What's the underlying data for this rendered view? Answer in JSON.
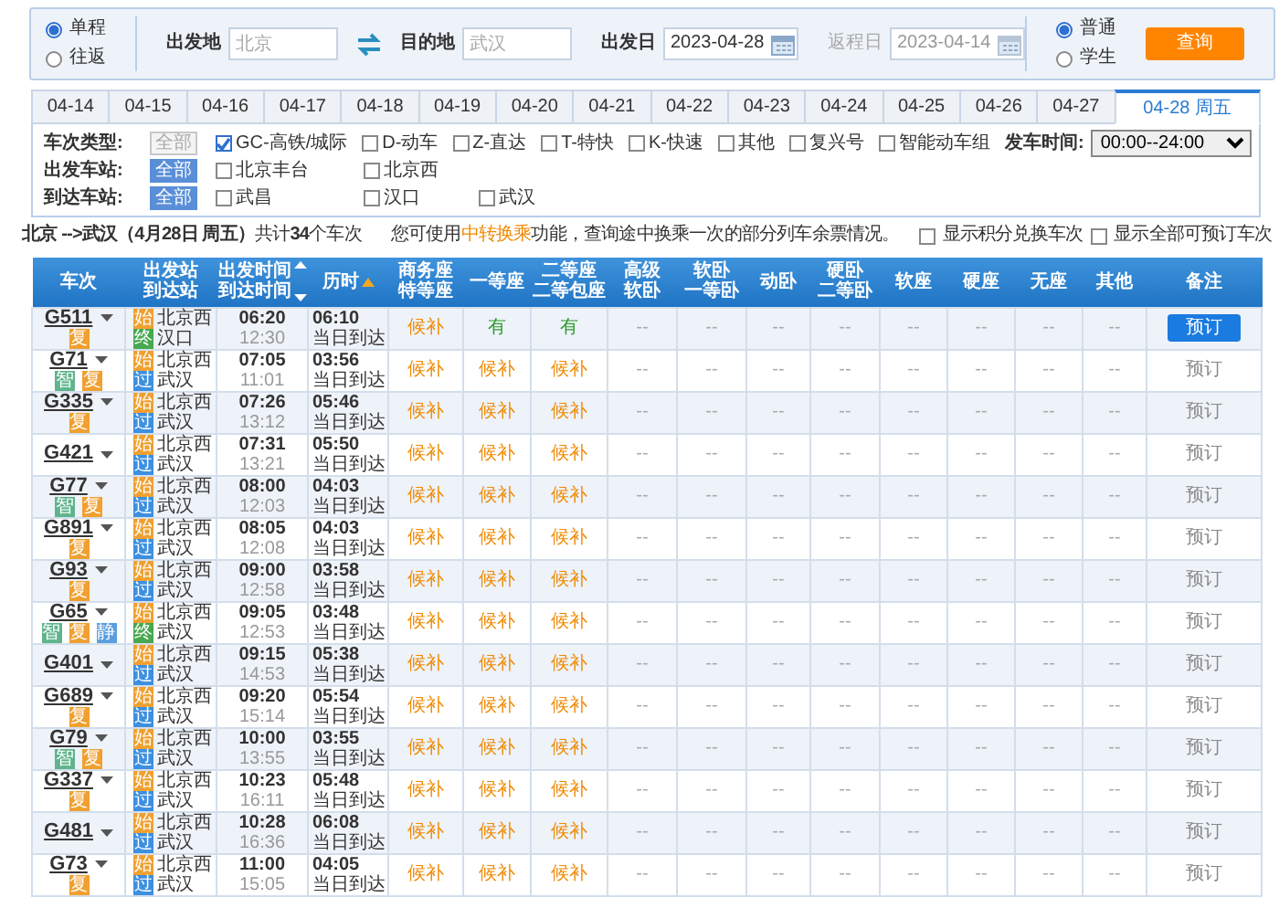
{
  "search": {
    "trip_types": [
      {
        "label": "单程",
        "selected": true
      },
      {
        "label": "往返",
        "selected": false
      }
    ],
    "from": {
      "label": "出发地",
      "placeholder": "北京"
    },
    "to": {
      "label": "目的地",
      "placeholder": "武汉"
    },
    "depart_date": {
      "label": "出发日",
      "value": "2023-04-28",
      "disabled": false
    },
    "return_date": {
      "label": "返程日",
      "value": "2023-04-14",
      "disabled": true
    },
    "passenger_types": [
      {
        "label": "普通",
        "selected": true
      },
      {
        "label": "学生",
        "selected": false
      }
    ],
    "button": "查询"
  },
  "date_tabs": [
    {
      "label": "04-14",
      "selected": false
    },
    {
      "label": "04-15",
      "selected": false
    },
    {
      "label": "04-16",
      "selected": false
    },
    {
      "label": "04-17",
      "selected": false
    },
    {
      "label": "04-18",
      "selected": false
    },
    {
      "label": "04-19",
      "selected": false
    },
    {
      "label": "04-20",
      "selected": false
    },
    {
      "label": "04-21",
      "selected": false
    },
    {
      "label": "04-22",
      "selected": false
    },
    {
      "label": "04-23",
      "selected": false
    },
    {
      "label": "04-24",
      "selected": false
    },
    {
      "label": "04-25",
      "selected": false
    },
    {
      "label": "04-26",
      "selected": false
    },
    {
      "label": "04-27",
      "selected": false
    },
    {
      "label": "04-28 周五",
      "selected": true
    }
  ],
  "filters": {
    "groups": [
      {
        "label": "车次类型:",
        "all": "全部",
        "all_selected": false,
        "options": [
          {
            "label": "GC-高铁/城际",
            "checked": true
          },
          {
            "label": "D-动车",
            "checked": false
          },
          {
            "label": "Z-直达",
            "checked": false
          },
          {
            "label": "T-特快",
            "checked": false
          },
          {
            "label": "K-快速",
            "checked": false
          },
          {
            "label": "其他",
            "checked": false
          },
          {
            "label": "复兴号",
            "checked": false
          },
          {
            "label": "智能动车组",
            "checked": false
          }
        ]
      },
      {
        "label": "出发车站:",
        "all": "全部",
        "all_selected": true,
        "options": [
          {
            "label": "北京丰台",
            "checked": false
          },
          {
            "label": "北京西",
            "checked": false
          }
        ]
      },
      {
        "label": "到达车站:",
        "all": "全部",
        "all_selected": true,
        "options": [
          {
            "label": "武昌",
            "checked": false
          },
          {
            "label": "汉口",
            "checked": false
          },
          {
            "label": "武汉",
            "checked": false
          }
        ]
      }
    ],
    "time": {
      "label": "发车时间:",
      "value": "00:00--24:00"
    }
  },
  "summary": {
    "route": "**北京 -->武汉（4月28日  周五）**共计**34**个车次",
    "notice_before": "您可使用",
    "notice_link": "中转换乘",
    "notice_after": "功能，查询途中换乘一次的部分列车余票情况。",
    "toggles": [
      {
        "label": "显示积分兑换车次",
        "checked": false
      },
      {
        "label": "显示全部可预订车次",
        "checked": false
      }
    ]
  },
  "table": {
    "columns": [
      {
        "lines": [
          "车次"
        ],
        "kind": "plain"
      },
      {
        "lines": [
          "出发站",
          "到达站"
        ],
        "kind": "plain"
      },
      {
        "lines": [
          "出发时间",
          "到达时间"
        ],
        "kind": "sortable"
      },
      {
        "lines": [
          "历时"
        ],
        "kind": "sorted"
      },
      {
        "lines": [
          "商务座",
          "特等座"
        ],
        "kind": "plain"
      },
      {
        "lines": [
          "一等座"
        ],
        "kind": "plain"
      },
      {
        "lines": [
          "二等座",
          "二等包座"
        ],
        "kind": "plain"
      },
      {
        "lines": [
          "高级",
          "软卧"
        ],
        "kind": "plain"
      },
      {
        "lines": [
          "软卧",
          "一等卧"
        ],
        "kind": "plain"
      },
      {
        "lines": [
          "动卧"
        ],
        "kind": "plain"
      },
      {
        "lines": [
          "硬卧",
          "二等卧"
        ],
        "kind": "plain"
      },
      {
        "lines": [
          "软座"
        ],
        "kind": "plain"
      },
      {
        "lines": [
          "硬座"
        ],
        "kind": "plain"
      },
      {
        "lines": [
          "无座"
        ],
        "kind": "plain"
      },
      {
        "lines": [
          "其他"
        ],
        "kind": "plain"
      },
      {
        "lines": [
          "备注"
        ],
        "kind": "plain"
      }
    ],
    "rows": [
      {
        "train": "G511",
        "badges": [
          {
            "text": "复",
            "color": "#f0a030"
          }
        ],
        "from": {
          "tag": "始",
          "kind": "origin",
          "name": "北京西"
        },
        "to": {
          "tag": "终",
          "kind": "terminal",
          "name": "汉口"
        },
        "depart": "06:20",
        "arrive": "12:30",
        "duration": "06:10",
        "arrival_day": "当日到达",
        "seats": [
          {
            "text": "候补",
            "kind": "waitlist"
          },
          {
            "text": "有",
            "kind": "available"
          },
          {
            "text": "有",
            "kind": "available"
          },
          {
            "text": "--",
            "kind": "none"
          },
          {
            "text": "--",
            "kind": "none"
          },
          {
            "text": "--",
            "kind": "none"
          },
          {
            "text": "--",
            "kind": "none"
          },
          {
            "text": "--",
            "kind": "none"
          },
          {
            "text": "--",
            "kind": "none"
          },
          {
            "text": "--",
            "kind": "none"
          },
          {
            "text": "--",
            "kind": "none"
          }
        ],
        "remark": {
          "label": "预订",
          "highlighted": true
        }
      },
      {
        "train": "G71",
        "badges": [
          {
            "text": "智",
            "color": "#5fb48c"
          },
          {
            "text": "复",
            "color": "#f0a030"
          }
        ],
        "from": {
          "tag": "始",
          "kind": "origin",
          "name": "北京西"
        },
        "to": {
          "tag": "过",
          "kind": "pass",
          "name": "武汉"
        },
        "depart": "07:05",
        "arrive": "11:01",
        "duration": "03:56",
        "arrival_day": "当日到达",
        "seats": [
          {
            "text": "候补",
            "kind": "waitlist"
          },
          {
            "text": "候补",
            "kind": "waitlist"
          },
          {
            "text": "候补",
            "kind": "waitlist"
          },
          {
            "text": "--",
            "kind": "none"
          },
          {
            "text": "--",
            "kind": "none"
          },
          {
            "text": "--",
            "kind": "none"
          },
          {
            "text": "--",
            "kind": "none"
          },
          {
            "text": "--",
            "kind": "none"
          },
          {
            "text": "--",
            "kind": "none"
          },
          {
            "text": "--",
            "kind": "none"
          },
          {
            "text": "--",
            "kind": "none"
          }
        ],
        "remark": {
          "label": "预订",
          "highlighted": false
        }
      },
      {
        "train": "G335",
        "badges": [
          {
            "text": "复",
            "color": "#f0a030"
          }
        ],
        "from": {
          "tag": "始",
          "kind": "origin",
          "name": "北京西"
        },
        "to": {
          "tag": "过",
          "kind": "pass",
          "name": "武汉"
        },
        "depart": "07:26",
        "arrive": "13:12",
        "duration": "05:46",
        "arrival_day": "当日到达",
        "seats": [
          {
            "text": "候补",
            "kind": "waitlist"
          },
          {
            "text": "候补",
            "kind": "waitlist"
          },
          {
            "text": "候补",
            "kind": "waitlist"
          },
          {
            "text": "--",
            "kind": "none"
          },
          {
            "text": "--",
            "kind": "none"
          },
          {
            "text": "--",
            "kind": "none"
          },
          {
            "text": "--",
            "kind": "none"
          },
          {
            "text": "--",
            "kind": "none"
          },
          {
            "text": "--",
            "kind": "none"
          },
          {
            "text": "--",
            "kind": "none"
          },
          {
            "text": "--",
            "kind": "none"
          }
        ],
        "remark": {
          "label": "预订",
          "highlighted": false
        }
      },
      {
        "train": "G421",
        "badges": [],
        "from": {
          "tag": "始",
          "kind": "origin",
          "name": "北京西"
        },
        "to": {
          "tag": "过",
          "kind": "pass",
          "name": "武汉"
        },
        "depart": "07:31",
        "arrive": "13:21",
        "duration": "05:50",
        "arrival_day": "当日到达",
        "seats": [
          {
            "text": "候补",
            "kind": "waitlist"
          },
          {
            "text": "候补",
            "kind": "waitlist"
          },
          {
            "text": "候补",
            "kind": "waitlist"
          },
          {
            "text": "--",
            "kind": "none"
          },
          {
            "text": "--",
            "kind": "none"
          },
          {
            "text": "--",
            "kind": "none"
          },
          {
            "text": "--",
            "kind": "none"
          },
          {
            "text": "--",
            "kind": "none"
          },
          {
            "text": "--",
            "kind": "none"
          },
          {
            "text": "--",
            "kind": "none"
          },
          {
            "text": "--",
            "kind": "none"
          }
        ],
        "remark": {
          "label": "预订",
          "highlighted": false
        }
      },
      {
        "train": "G77",
        "badges": [
          {
            "text": "智",
            "color": "#5fb48c"
          },
          {
            "text": "复",
            "color": "#f0a030"
          }
        ],
        "from": {
          "tag": "始",
          "kind": "origin",
          "name": "北京西"
        },
        "to": {
          "tag": "过",
          "kind": "pass",
          "name": "武汉"
        },
        "depart": "08:00",
        "arrive": "12:03",
        "duration": "04:03",
        "arrival_day": "当日到达",
        "seats": [
          {
            "text": "候补",
            "kind": "waitlist"
          },
          {
            "text": "候补",
            "kind": "waitlist"
          },
          {
            "text": "候补",
            "kind": "waitlist"
          },
          {
            "text": "--",
            "kind": "none"
          },
          {
            "text": "--",
            "kind": "none"
          },
          {
            "text": "--",
            "kind": "none"
          },
          {
            "text": "--",
            "kind": "none"
          },
          {
            "text": "--",
            "kind": "none"
          },
          {
            "text": "--",
            "kind": "none"
          },
          {
            "text": "--",
            "kind": "none"
          },
          {
            "text": "--",
            "kind": "none"
          }
        ],
        "remark": {
          "label": "预订",
          "highlighted": false
        }
      },
      {
        "train": "G891",
        "badges": [
          {
            "text": "复",
            "color": "#f0a030"
          }
        ],
        "from": {
          "tag": "始",
          "kind": "origin",
          "name": "北京西"
        },
        "to": {
          "tag": "过",
          "kind": "pass",
          "name": "武汉"
        },
        "depart": "08:05",
        "arrive": "12:08",
        "duration": "04:03",
        "arrival_day": "当日到达",
        "seats": [
          {
            "text": "候补",
            "kind": "waitlist"
          },
          {
            "text": "候补",
            "kind": "waitlist"
          },
          {
            "text": "候补",
            "kind": "waitlist"
          },
          {
            "text": "--",
            "kind": "none"
          },
          {
            "text": "--",
            "kind": "none"
          },
          {
            "text": "--",
            "kind": "none"
          },
          {
            "text": "--",
            "kind": "none"
          },
          {
            "text": "--",
            "kind": "none"
          },
          {
            "text": "--",
            "kind": "none"
          },
          {
            "text": "--",
            "kind": "none"
          },
          {
            "text": "--",
            "kind": "none"
          }
        ],
        "remark": {
          "label": "预订",
          "highlighted": false
        }
      },
      {
        "train": "G93",
        "badges": [
          {
            "text": "复",
            "color": "#f0a030"
          }
        ],
        "from": {
          "tag": "始",
          "kind": "origin",
          "name": "北京西"
        },
        "to": {
          "tag": "过",
          "kind": "pass",
          "name": "武汉"
        },
        "depart": "09:00",
        "arrive": "12:58",
        "duration": "03:58",
        "arrival_day": "当日到达",
        "seats": [
          {
            "text": "候补",
            "kind": "waitlist"
          },
          {
            "text": "候补",
            "kind": "waitlist"
          },
          {
            "text": "候补",
            "kind": "waitlist"
          },
          {
            "text": "--",
            "kind": "none"
          },
          {
            "text": "--",
            "kind": "none"
          },
          {
            "text": "--",
            "kind": "none"
          },
          {
            "text": "--",
            "kind": "none"
          },
          {
            "text": "--",
            "kind": "none"
          },
          {
            "text": "--",
            "kind": "none"
          },
          {
            "text": "--",
            "kind": "none"
          },
          {
            "text": "--",
            "kind": "none"
          }
        ],
        "remark": {
          "label": "预订",
          "highlighted": false
        }
      },
      {
        "train": "G65",
        "badges": [
          {
            "text": "智",
            "color": "#5fb48c"
          },
          {
            "text": "复",
            "color": "#f0a030"
          },
          {
            "text": "静",
            "color": "#5a9ee0"
          }
        ],
        "from": {
          "tag": "始",
          "kind": "origin",
          "name": "北京西"
        },
        "to": {
          "tag": "终",
          "kind": "terminal",
          "name": "武汉"
        },
        "depart": "09:05",
        "arrive": "12:53",
        "duration": "03:48",
        "arrival_day": "当日到达",
        "seats": [
          {
            "text": "候补",
            "kind": "waitlist"
          },
          {
            "text": "候补",
            "kind": "waitlist"
          },
          {
            "text": "候补",
            "kind": "waitlist"
          },
          {
            "text": "--",
            "kind": "none"
          },
          {
            "text": "--",
            "kind": "none"
          },
          {
            "text": "--",
            "kind": "none"
          },
          {
            "text": "--",
            "kind": "none"
          },
          {
            "text": "--",
            "kind": "none"
          },
          {
            "text": "--",
            "kind": "none"
          },
          {
            "text": "--",
            "kind": "none"
          },
          {
            "text": "--",
            "kind": "none"
          }
        ],
        "remark": {
          "label": "预订",
          "highlighted": false
        }
      },
      {
        "train": "G401",
        "badges": [],
        "from": {
          "tag": "始",
          "kind": "origin",
          "name": "北京西"
        },
        "to": {
          "tag": "过",
          "kind": "pass",
          "name": "武汉"
        },
        "depart": "09:15",
        "arrive": "14:53",
        "duration": "05:38",
        "arrival_day": "当日到达",
        "seats": [
          {
            "text": "候补",
            "kind": "waitlist"
          },
          {
            "text": "候补",
            "kind": "waitlist"
          },
          {
            "text": "候补",
            "kind": "waitlist"
          },
          {
            "text": "--",
            "kind": "none"
          },
          {
            "text": "--",
            "kind": "none"
          },
          {
            "text": "--",
            "kind": "none"
          },
          {
            "text": "--",
            "kind": "none"
          },
          {
            "text": "--",
            "kind": "none"
          },
          {
            "text": "--",
            "kind": "none"
          },
          {
            "text": "--",
            "kind": "none"
          },
          {
            "text": "--",
            "kind": "none"
          }
        ],
        "remark": {
          "label": "预订",
          "highlighted": false
        }
      },
      {
        "train": "G689",
        "badges": [
          {
            "text": "复",
            "color": "#f0a030"
          }
        ],
        "from": {
          "tag": "始",
          "kind": "origin",
          "name": "北京西"
        },
        "to": {
          "tag": "过",
          "kind": "pass",
          "name": "武汉"
        },
        "depart": "09:20",
        "arrive": "15:14",
        "duration": "05:54",
        "arrival_day": "当日到达",
        "seats": [
          {
            "text": "候补",
            "kind": "waitlist"
          },
          {
            "text": "候补",
            "kind": "waitlist"
          },
          {
            "text": "候补",
            "kind": "waitlist"
          },
          {
            "text": "--",
            "kind": "none"
          },
          {
            "text": "--",
            "kind": "none"
          },
          {
            "text": "--",
            "kind": "none"
          },
          {
            "text": "--",
            "kind": "none"
          },
          {
            "text": "--",
            "kind": "none"
          },
          {
            "text": "--",
            "kind": "none"
          },
          {
            "text": "--",
            "kind": "none"
          },
          {
            "text": "--",
            "kind": "none"
          }
        ],
        "remark": {
          "label": "预订",
          "highlighted": false
        }
      },
      {
        "train": "G79",
        "badges": [
          {
            "text": "智",
            "color": "#5fb48c"
          },
          {
            "text": "复",
            "color": "#f0a030"
          }
        ],
        "from": {
          "tag": "始",
          "kind": "origin",
          "name": "北京西"
        },
        "to": {
          "tag": "过",
          "kind": "pass",
          "name": "武汉"
        },
        "depart": "10:00",
        "arrive": "13:55",
        "duration": "03:55",
        "arrival_day": "当日到达",
        "seats": [
          {
            "text": "候补",
            "kind": "waitlist"
          },
          {
            "text": "候补",
            "kind": "waitlist"
          },
          {
            "text": "候补",
            "kind": "waitlist"
          },
          {
            "text": "--",
            "kind": "none"
          },
          {
            "text": "--",
            "kind": "none"
          },
          {
            "text": "--",
            "kind": "none"
          },
          {
            "text": "--",
            "kind": "none"
          },
          {
            "text": "--",
            "kind": "none"
          },
          {
            "text": "--",
            "kind": "none"
          },
          {
            "text": "--",
            "kind": "none"
          },
          {
            "text": "--",
            "kind": "none"
          }
        ],
        "remark": {
          "label": "预订",
          "highlighted": false
        }
      },
      {
        "train": "G337",
        "badges": [
          {
            "text": "复",
            "color": "#f0a030"
          }
        ],
        "from": {
          "tag": "始",
          "kind": "origin",
          "name": "北京西"
        },
        "to": {
          "tag": "过",
          "kind": "pass",
          "name": "武汉"
        },
        "depart": "10:23",
        "arrive": "16:11",
        "duration": "05:48",
        "arrival_day": "当日到达",
        "seats": [
          {
            "text": "候补",
            "kind": "waitlist"
          },
          {
            "text": "候补",
            "kind": "waitlist"
          },
          {
            "text": "候补",
            "kind": "waitlist"
          },
          {
            "text": "--",
            "kind": "none"
          },
          {
            "text": "--",
            "kind": "none"
          },
          {
            "text": "--",
            "kind": "none"
          },
          {
            "text": "--",
            "kind": "none"
          },
          {
            "text": "--",
            "kind": "none"
          },
          {
            "text": "--",
            "kind": "none"
          },
          {
            "text": "--",
            "kind": "none"
          },
          {
            "text": "--",
            "kind": "none"
          }
        ],
        "remark": {
          "label": "预订",
          "highlighted": false
        }
      },
      {
        "train": "G481",
        "badges": [],
        "from": {
          "tag": "始",
          "kind": "origin",
          "name": "北京西"
        },
        "to": {
          "tag": "过",
          "kind": "pass",
          "name": "武汉"
        },
        "depart": "10:28",
        "arrive": "16:36",
        "duration": "06:08",
        "arrival_day": "当日到达",
        "seats": [
          {
            "text": "候补",
            "kind": "waitlist"
          },
          {
            "text": "候补",
            "kind": "waitlist"
          },
          {
            "text": "候补",
            "kind": "waitlist"
          },
          {
            "text": "--",
            "kind": "none"
          },
          {
            "text": "--",
            "kind": "none"
          },
          {
            "text": "--",
            "kind": "none"
          },
          {
            "text": "--",
            "kind": "none"
          },
          {
            "text": "--",
            "kind": "none"
          },
          {
            "text": "--",
            "kind": "none"
          },
          {
            "text": "--",
            "kind": "none"
          },
          {
            "text": "--",
            "kind": "none"
          }
        ],
        "remark": {
          "label": "预订",
          "highlighted": false
        }
      },
      {
        "train": "G73",
        "badges": [
          {
            "text": "复",
            "color": "#f0a030"
          }
        ],
        "from": {
          "tag": "始",
          "kind": "origin",
          "name": "北京西"
        },
        "to": {
          "tag": "过",
          "kind": "pass",
          "name": "武汉"
        },
        "depart": "11:00",
        "arrive": "15:05",
        "duration": "04:05",
        "arrival_day": "当日到达",
        "seats": [
          {
            "text": "候补",
            "kind": "waitlist"
          },
          {
            "text": "候补",
            "kind": "waitlist"
          },
          {
            "text": "候补",
            "kind": "waitlist"
          },
          {
            "text": "--",
            "kind": "none"
          },
          {
            "text": "--",
            "kind": "none"
          },
          {
            "text": "--",
            "kind": "none"
          },
          {
            "text": "--",
            "kind": "none"
          },
          {
            "text": "--",
            "kind": "none"
          },
          {
            "text": "--",
            "kind": "none"
          },
          {
            "text": "--",
            "kind": "none"
          },
          {
            "text": "--",
            "kind": "none"
          }
        ],
        "remark": {
          "label": "预订",
          "highlighted": false
        }
      }
    ]
  }
}
